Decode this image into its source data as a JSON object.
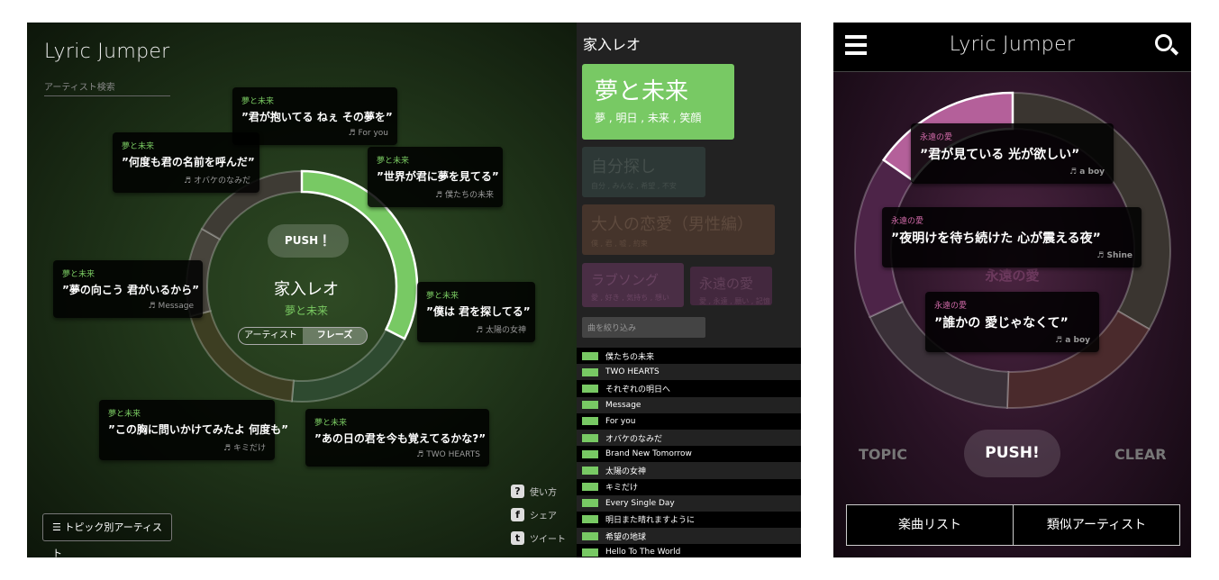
{
  "desktop": {
    "logo": "Lyric Jumper",
    "search_placeholder": "アーティスト検索",
    "push_label": "PUSH❕",
    "artist": "家入レオ",
    "topic": "夢と未来",
    "toggle": [
      "アーティスト",
      "フレーズ"
    ],
    "toggle_active": "フレーズ",
    "topic_artists_label": "トピック別アーティスト",
    "links": [
      "使い方",
      "シェア",
      "ツイート"
    ],
    "bubbles": [
      {
        "topic": "夢と未来",
        "phrase": "”君が抱いてる ねぇ その夢を”",
        "song": "♬ For you"
      },
      {
        "topic": "夢と未来",
        "phrase": "”何度も君の名前を呼んだ”",
        "song": "♬ オバケのなみだ"
      },
      {
        "topic": "夢と未来",
        "phrase": "”世界が君に夢を見てる”",
        "song": "♬ 僕たちの未来"
      },
      {
        "topic": "夢と未来",
        "phrase": "”夢の向こう 君がいるから”",
        "song": "♬ Message"
      },
      {
        "topic": "夢と未来",
        "phrase": "”僕は 君を探してる”",
        "song": "♬ 太陽の女神"
      },
      {
        "topic": "夢と未来",
        "phrase": "”この胸に問いかけてみたよ 何度も”",
        "song": "♬ キミだけ"
      },
      {
        "topic": "夢と未来",
        "phrase": "”あの日の君を今も覚えてるかな?”",
        "song": "♬ TWO HEARTS"
      }
    ]
  },
  "sidebar": {
    "artist": "家入レオ",
    "topics": [
      {
        "name": "夢と未来",
        "keywords": "夢 , 明日 , 未来 , 笑顔",
        "color": "#78c964",
        "active": true
      },
      {
        "name": "自分探し",
        "keywords": "自分 , みんな , 希望 , 不安",
        "color": "#2d3836"
      },
      {
        "name": "大人の恋愛（男性編）",
        "keywords": "僕 , 君 , 嘘 , 約束",
        "color": "#45342b"
      },
      {
        "name": "ラブソング",
        "keywords": "愛 , 好き , 気持ち , 想い",
        "color": "#4a2e45"
      },
      {
        "name": "永遠の愛",
        "keywords": "愛 , 永遠 , 願い , 記憶",
        "color": "#43283e"
      }
    ],
    "filter_placeholder": "曲を絞り込み",
    "songs": [
      "僕たちの未来",
      "TWO HEARTS",
      "それぞれの明日へ",
      "Message",
      "For you",
      "オバケのなみだ",
      "Brand New Tomorrow",
      "太陽の女神",
      "キミだけ",
      "Every Single Day",
      "明日また晴れますように",
      "希望の地球",
      "Hello To The World"
    ]
  },
  "mobile": {
    "logo": "Lyric Jumper",
    "center_topic": "永遠の愛",
    "bubbles": [
      {
        "topic": "永遠の愛",
        "phrase": "”君が見ている 光が欲しい”",
        "song": "♬ a boy"
      },
      {
        "topic": "永遠の愛",
        "phrase": "”夜明けを待ち続けた 心が震える夜”",
        "song": "♬ Shine"
      },
      {
        "topic": "永遠の愛",
        "phrase": "”誰かの 愛じゃなくて”",
        "song": "♬ a boy"
      }
    ],
    "topic_label": "TOPIC",
    "push_label": "PUSH!",
    "clear_label": "CLEAR",
    "buttons": [
      "楽曲リスト",
      "類似アーティスト"
    ]
  }
}
